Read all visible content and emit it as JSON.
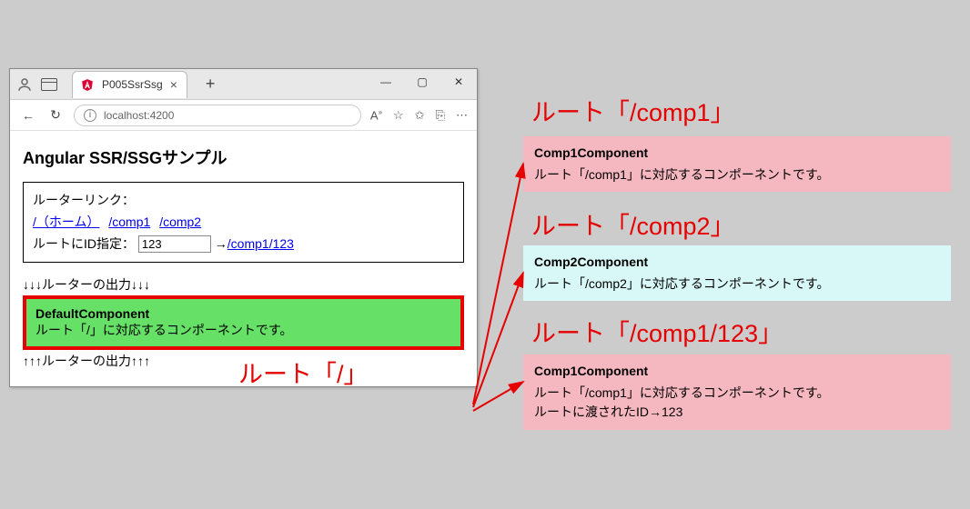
{
  "browser": {
    "tab_title": "P005SsrSsg",
    "url": "localhost:4200",
    "window_controls": {
      "min": "—",
      "max": "▢",
      "close": "✕"
    }
  },
  "page": {
    "heading": "Angular SSR/SSGサンプル",
    "links_label": "ルーターリンク：",
    "link_home": "/（ホーム）",
    "link_comp1": "/comp1",
    "link_comp2": "/comp2",
    "id_label": "ルートにID指定：",
    "id_value": "123",
    "id_link_arrow": "→",
    "id_link_text": "/comp1/123",
    "arrows_down": "↓↓↓ルーターの出力↓↓↓",
    "arrows_up": "↑↑↑ルーターの出力↑↑↑"
  },
  "output": {
    "title": "DefaultComponent",
    "body": "ルート「/」に対応するコンポーネントです。"
  },
  "labels": {
    "root": "ルート「/」",
    "comp1": "ルート「/comp1」",
    "comp2": "ルート「/comp2」",
    "comp1id": "ルート「/comp1/123」"
  },
  "cards": {
    "c1_title": "Comp1Component",
    "c1_body": "ルート「/comp1」に対応するコンポーネントです。",
    "c2_title": "Comp2Component",
    "c2_body": "ルート「/comp2」に対応するコンポーネントです。",
    "c3_title": "Comp1Component",
    "c3_body1": "ルート「/comp1」に対応するコンポーネントです。",
    "c3_body2": "ルートに渡されたID→123"
  }
}
